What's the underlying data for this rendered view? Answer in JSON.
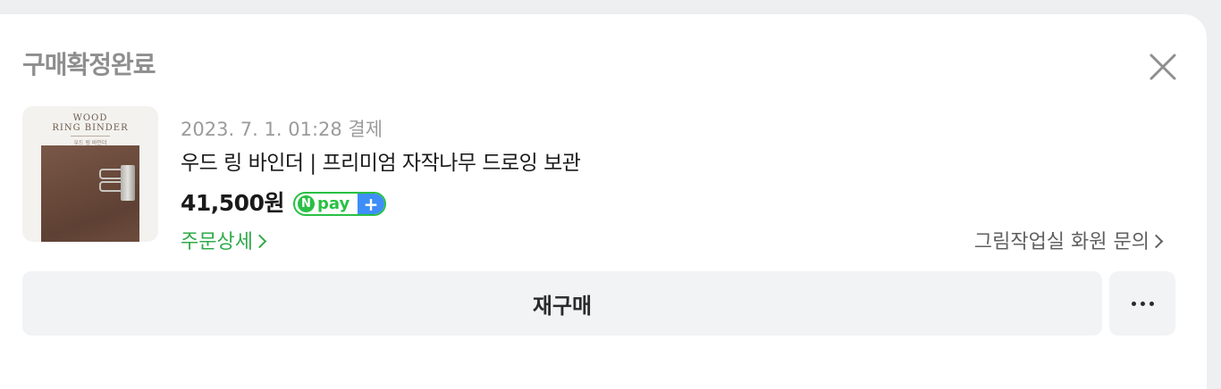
{
  "header": {
    "status_title": "구매확정완료",
    "close_icon": "close-icon"
  },
  "product": {
    "thumbnail": {
      "title_line1": "WOOD",
      "title_line2": "RING BINDER",
      "subtitle": "우드 링 바인더"
    },
    "paid_date": "2023. 7. 1. 01:28 결제",
    "name": "우드 링 바인더 | 프리미엄 자작나무 드로잉 보관",
    "price": "41,500원",
    "npay_badge": {
      "letter": "N",
      "text": "pay",
      "plus": "+"
    },
    "colors": {
      "npay_green": "#28c044",
      "npay_blue": "#3e8ef7",
      "link_green": "#2faa4a"
    }
  },
  "links": {
    "order_detail": "주문상세",
    "seller_inquiry": "그림작업실 화원 문의"
  },
  "actions": {
    "rebuy_label": "재구매",
    "more_icon": "more-horizontal-icon"
  }
}
